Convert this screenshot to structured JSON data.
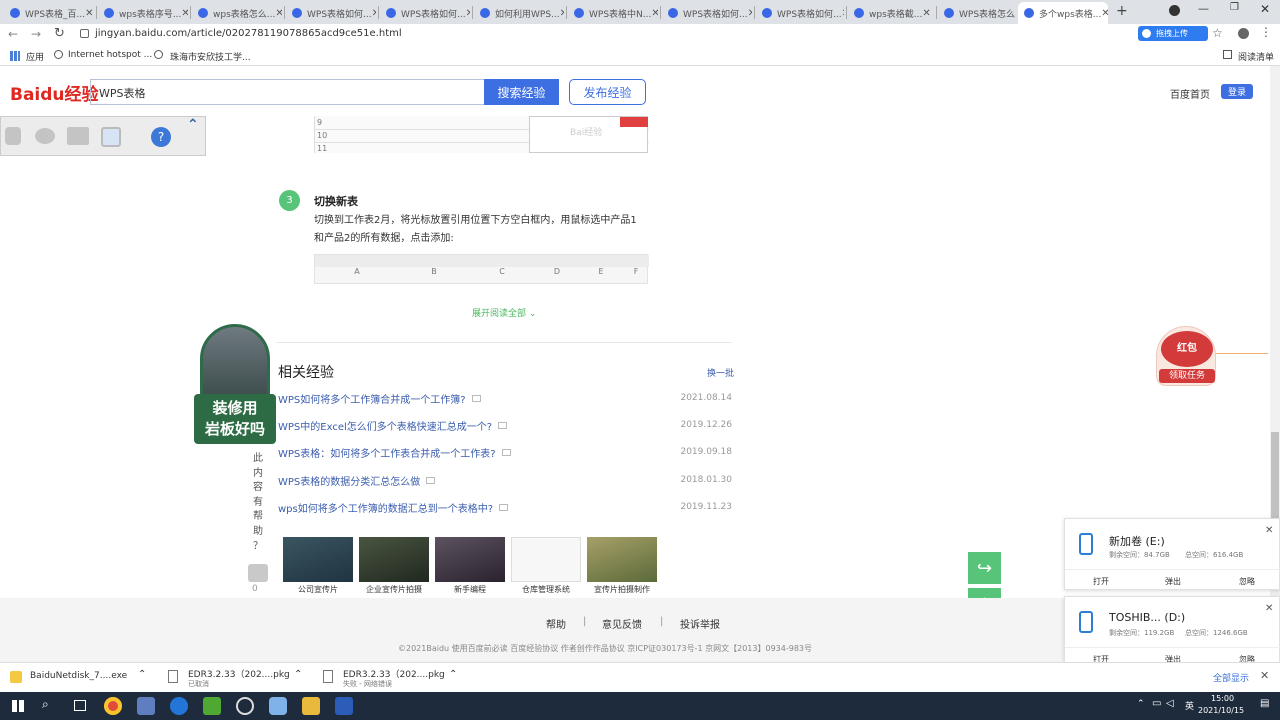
{
  "browser": {
    "tabs": [
      {
        "label": "WPS表格_百..."
      },
      {
        "label": "wps表格序号..."
      },
      {
        "label": "wps表格怎么..."
      },
      {
        "label": "WPS表格如何..."
      },
      {
        "label": "WPS表格如何..."
      },
      {
        "label": "如何利用WPS..."
      },
      {
        "label": "WPS表格中N..."
      },
      {
        "label": "WPS表格如何..."
      },
      {
        "label": "WPS表格如何..."
      },
      {
        "label": "wps表格截..."
      },
      {
        "label": "WPS表格怎么..."
      },
      {
        "label": "多个wps表格..."
      }
    ],
    "url": "jingyan.baidu.com/article/020278119078865acd9ce51e.html",
    "upload_badge": "拖拽上传",
    "bookmarks": {
      "apps": "应用",
      "hotspot": "Internet hotspot ...",
      "item2": "珠海市安欣技工学...",
      "reading_list": "阅读清单"
    }
  },
  "header": {
    "logo": "Baidu经验",
    "search_value": "WPS表格",
    "search_button": "搜索经验",
    "publish_button": "发布经验",
    "home_link": "百度首页",
    "login_button": "登录"
  },
  "article": {
    "step_number": "3",
    "step_title": "切换新表",
    "step_text_1": "切换到工作表2月，将光标放置引用位置下方空白框内，用鼠标选中产品1",
    "step_text_2": "和产品2的所有数据，点击添加:",
    "expand_link": "展开阅读全部",
    "sheet_cols": [
      "A",
      "B",
      "C",
      "D",
      "E",
      "F"
    ],
    "sheet_rows": [
      "9",
      "10",
      "11"
    ],
    "watermark": "Bai经验"
  },
  "side_ad": {
    "line1": "装修用",
    "line2": "岩板好吗"
  },
  "helpful": {
    "vertical": [
      "此",
      "内",
      "容",
      "有",
      "帮",
      "助",
      "？"
    ],
    "up_count": "0"
  },
  "related": {
    "title": "相关经验",
    "refresh": "换一批",
    "items": [
      {
        "title": "WPS如何将多个工作簿合并成一个工作簿?",
        "date": "2021.08.14"
      },
      {
        "title": "WPS中的Excel怎么们多个表格快速汇总成一个?",
        "date": "2019.12.26"
      },
      {
        "title": "WPS表格：如何将多个工作表合并成一个工作表?",
        "date": "2019.09.18"
      },
      {
        "title": "WPS表格的数据分类汇总怎么做",
        "date": "2018.01.30"
      },
      {
        "title": "wps如何将多个工作簿的数据汇总到一个表格中?",
        "date": "2019.11.23"
      }
    ],
    "images": [
      {
        "caption": "公司宣传片"
      },
      {
        "caption": "企业宣传片拍摄"
      },
      {
        "caption": "新手编程"
      },
      {
        "caption": "仓库管理系统"
      },
      {
        "caption": "宣传片拍摄制作"
      }
    ]
  },
  "redpacket": {
    "title": "红包",
    "subtitle": "领取任务"
  },
  "footer": {
    "links": [
      "帮助",
      "意见反馈",
      "投诉举报"
    ],
    "copyright": "©2021Baidu  使用百度前必读  百度经验协议  作者创作作品协议  京ICP证030173号-1 京网文【2013】0934-983号"
  },
  "usb": [
    {
      "name": "新加卷 (E:)",
      "free": "剩余空间：84.7GB",
      "total": "总空间：616.4GB",
      "open": "打开",
      "eject": "弹出",
      "ignore": "忽略"
    },
    {
      "name": "TOSHIB... (D:)",
      "free": "剩余空间：119.2GB",
      "total": "总空间：1246.6GB",
      "open": "打开",
      "eject": "弹出",
      "ignore": "忽略"
    }
  ],
  "downloads": {
    "items": [
      {
        "name": "BaiduNetdisk_7....exe",
        "status": ""
      },
      {
        "name": "EDR3.2.33（202....pkg",
        "status": "已取消"
      },
      {
        "name": "EDR3.2.33（202....pkg",
        "status": "失败 - 网络错误"
      }
    ],
    "show_all": "全部显示"
  },
  "taskbar": {
    "time": "15:00",
    "date": "2021/10/15",
    "ime": "英"
  }
}
